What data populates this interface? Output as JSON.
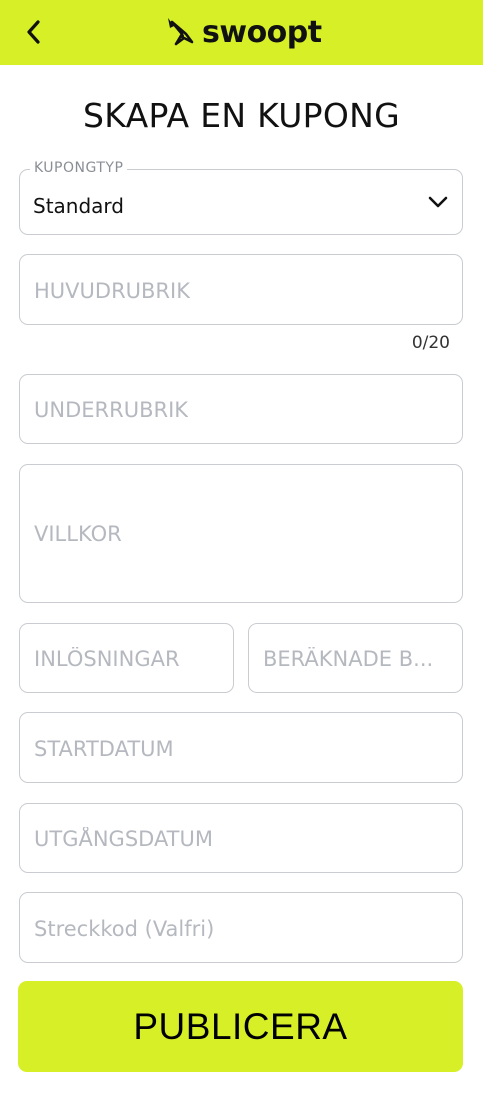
{
  "header": {
    "logo_text": "swoopt",
    "background": "#d6ef27",
    "back_icon": "chevron-left-icon"
  },
  "page_title": "SKAPA EN KUPONG",
  "form": {
    "coupon_type": {
      "label": "KUPONGTYP",
      "value": "Standard"
    },
    "headline": {
      "placeholder": "HUVUDRUBRIK",
      "counter": "0/20"
    },
    "subheadline": {
      "placeholder": "UNDERRUBRIK"
    },
    "terms": {
      "placeholder": "VILLKOR"
    },
    "redemptions": {
      "placeholder": "INLÖSNINGAR"
    },
    "estimated": {
      "placeholder": "BERÄKNADE B..."
    },
    "start_date": {
      "placeholder": "STARTDATUM"
    },
    "expiry_date": {
      "placeholder": "UTGÅNGSDATUM"
    },
    "barcode": {
      "placeholder": "Streckkod (Valfri)"
    }
  },
  "publish_button": {
    "label": "PUBLICERA",
    "color": "#d6ef27"
  }
}
